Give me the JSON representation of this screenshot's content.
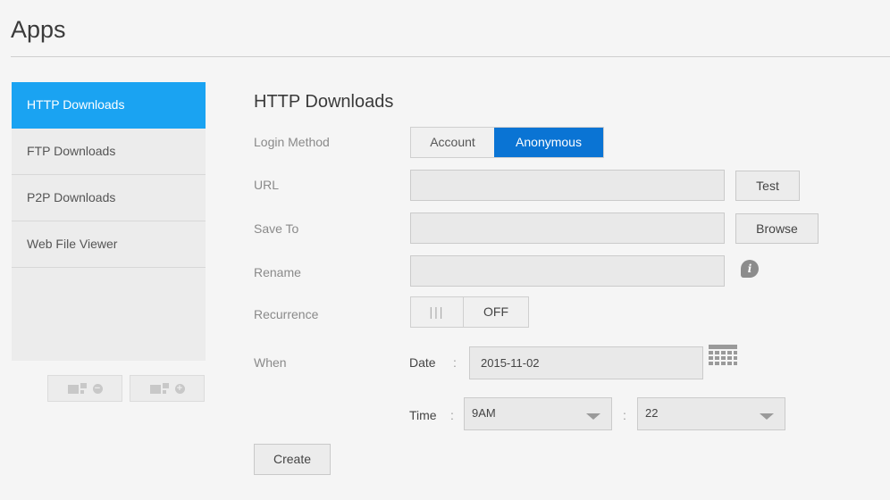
{
  "page": {
    "title": "Apps"
  },
  "sidebar": {
    "items": [
      {
        "label": "HTTP Downloads",
        "active": true
      },
      {
        "label": "FTP Downloads"
      },
      {
        "label": "P2P Downloads"
      },
      {
        "label": "Web File Viewer"
      }
    ],
    "buttons": [
      {
        "icon": "remove-app-icon"
      },
      {
        "icon": "add-app-icon"
      }
    ]
  },
  "main": {
    "title": "HTTP Downloads",
    "login_method": {
      "label": "Login Method",
      "options": [
        "Account",
        "Anonymous"
      ],
      "selected": "Anonymous"
    },
    "url": {
      "label": "URL",
      "value": "",
      "button": "Test"
    },
    "save_to": {
      "label": "Save To",
      "value": "",
      "button": "Browse"
    },
    "rename": {
      "label": "Rename",
      "value": "",
      "info_icon": "i"
    },
    "recurrence": {
      "label": "Recurrence",
      "knob": "|||",
      "state": "OFF"
    },
    "when": {
      "label": "When",
      "date_label": "Date",
      "date_value": "2015-11-02",
      "time_label": "Time",
      "separator": ":",
      "hour": "9AM",
      "minute": "22"
    },
    "create_button": "Create"
  },
  "colors": {
    "accent": "#1aa3f2",
    "selected": "#0a74d4"
  }
}
